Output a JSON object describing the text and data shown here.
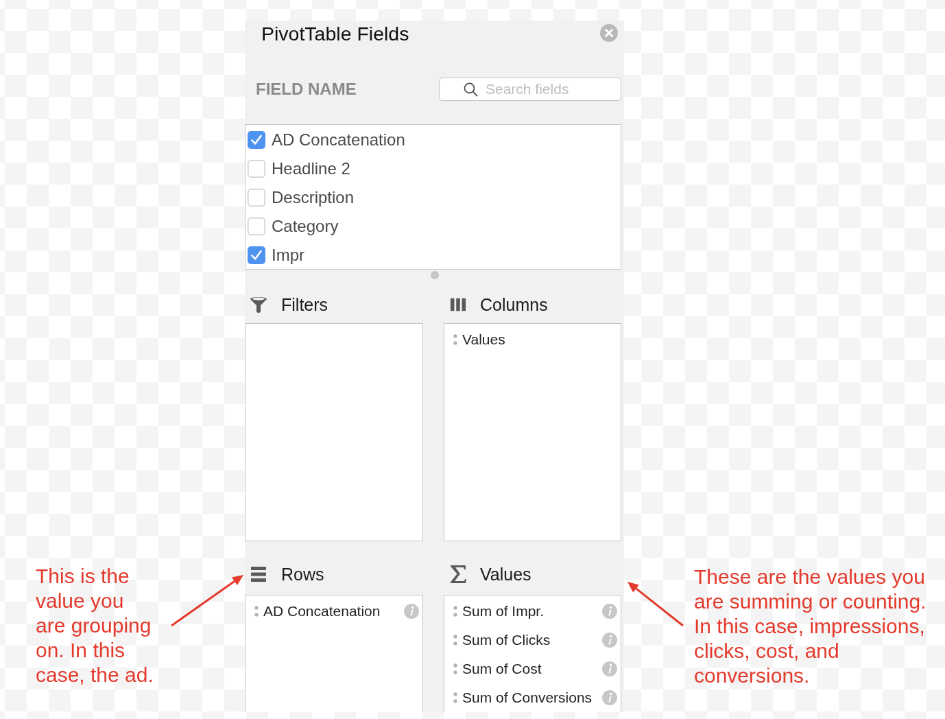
{
  "panel": {
    "title": "PivotTable Fields",
    "search_label": "FIELD NAME",
    "search": {
      "placeholder": "Search fields"
    },
    "fields": [
      {
        "label": "AD Concatenation",
        "checked": true
      },
      {
        "label": "Headline 2",
        "checked": false
      },
      {
        "label": "Description",
        "checked": false
      },
      {
        "label": "Category",
        "checked": false
      },
      {
        "label": "Impr",
        "checked": true
      }
    ],
    "areas": [
      {
        "kind": "filters",
        "title": "Filters"
      },
      {
        "kind": "columns",
        "title": "Columns",
        "items": [
          {
            "kind": "summary",
            "label": "Values"
          }
        ]
      },
      {
        "kind": "rows",
        "title": "Rows",
        "items": [
          {
            "kind": "field",
            "label": "AD Concatenation"
          }
        ]
      },
      {
        "kind": "values",
        "title": "Values",
        "items": [
          {
            "kind": "field",
            "label": "Sum of Impr."
          },
          {
            "kind": "field",
            "label": "Sum of Clicks"
          },
          {
            "kind": "field",
            "label": "Sum of Cost"
          },
          {
            "kind": "field",
            "label": "Sum of Conversions"
          }
        ]
      }
    ]
  },
  "annotations": [
    {
      "kind": "left",
      "text": "This is the value you are grouping on. In this case, the ad."
    },
    {
      "kind": "right",
      "text": "These are the values you are summing or counting. In this case, impressions, clicks, cost, and conversions."
    }
  ]
}
